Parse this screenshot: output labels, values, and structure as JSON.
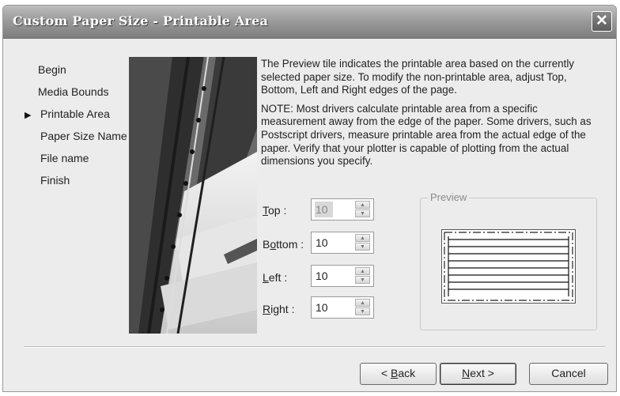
{
  "window": {
    "title": "Custom Paper Size - Printable Area",
    "close_label": "✕"
  },
  "steps": [
    {
      "label": "Begin",
      "current": false
    },
    {
      "label": "Media Bounds",
      "current": false
    },
    {
      "label": "Printable Area",
      "current": true
    },
    {
      "label": "Paper Size Name",
      "current": false
    },
    {
      "label": "File name",
      "current": false
    },
    {
      "label": "Finish",
      "current": false
    }
  ],
  "current_marker": "▶",
  "description": {
    "para1": "The Preview tile indicates the printable area based on the currently selected paper size. To modify the non-printable area, adjust Top, Bottom, Left and Right edges of the page.",
    "para2": "NOTE: Most drivers calculate printable area from a specific measurement away from the edge of the paper. Some drivers, such as Postscript drivers, measure printable area from the actual edge of the paper. Verify that your plotter is capable of plotting from the actual dimensions you specify."
  },
  "fields": {
    "top": {
      "mnemonic": "T",
      "rest": "op :",
      "value": "10"
    },
    "bottom": {
      "mnemonic": "o",
      "pre": "B",
      "rest": "ttom :",
      "value": "10"
    },
    "left": {
      "mnemonic": "L",
      "rest": "eft :",
      "value": "10"
    },
    "right": {
      "mnemonic": "R",
      "rest": "ight :",
      "value": "10"
    }
  },
  "preview": {
    "label": "Preview"
  },
  "buttons": {
    "back": {
      "prefix": "< ",
      "mnemonic": "B",
      "rest": "ack"
    },
    "next": {
      "mnemonic": "N",
      "rest": "ext >"
    },
    "cancel": "Cancel"
  }
}
